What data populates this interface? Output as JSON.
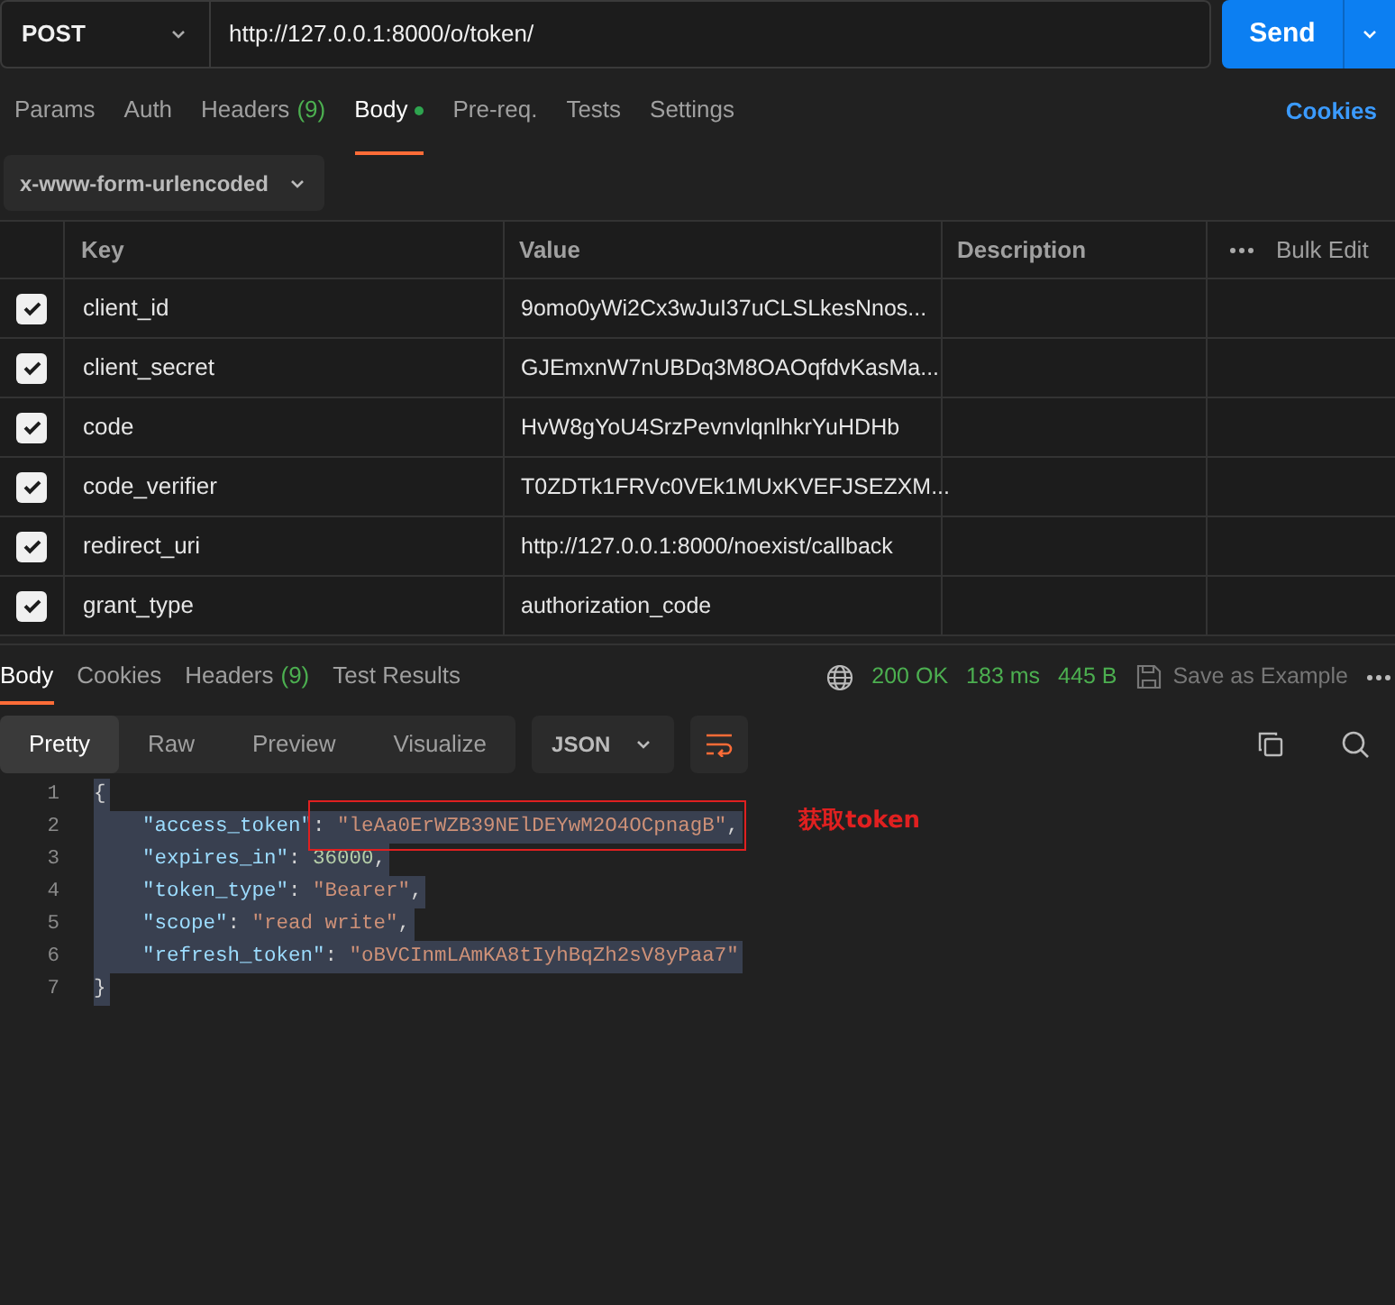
{
  "request": {
    "method": "POST",
    "url": "http://127.0.0.1:8000/o/token/",
    "send": "Send"
  },
  "request_tabs": [
    {
      "label": "Params",
      "selected": false,
      "dot": false
    },
    {
      "label": "Auth",
      "selected": false,
      "dot": false
    },
    {
      "label": "Headers",
      "count": "(9)",
      "selected": false,
      "dot": false
    },
    {
      "label": "Body",
      "selected": true,
      "dot": true
    },
    {
      "label": "Pre-req.",
      "selected": false,
      "dot": false
    },
    {
      "label": "Tests",
      "selected": false,
      "dot": false
    },
    {
      "label": "Settings",
      "selected": false,
      "dot": false
    }
  ],
  "cookies_link": "Cookies",
  "body_type": "x-www-form-urlencoded",
  "table": {
    "columns": [
      "Key",
      "Value",
      "Description"
    ],
    "bulk_edit": "Bulk Edit",
    "rows": [
      {
        "checked": true,
        "key": "client_id",
        "value": "9omo0yWi2Cx3wJuI37uCLSLkesNnos..."
      },
      {
        "checked": true,
        "key": "client_secret",
        "value": "GJEmxnW7nUBDq3M8OAOqfdvKasMa..."
      },
      {
        "checked": true,
        "key": "code",
        "value": "HvW8gYoU4SrzPevnvlqnlhkrYuHDHb"
      },
      {
        "checked": true,
        "key": "code_verifier",
        "value": "T0ZDTk1FRVc0VEk1MUxKVEFJSEZXM..."
      },
      {
        "checked": true,
        "key": "redirect_uri",
        "value": "http://127.0.0.1:8000/noexist/callback"
      },
      {
        "checked": true,
        "key": "grant_type",
        "value": "authorization_code"
      }
    ]
  },
  "response_tabs": [
    {
      "label": "Body",
      "selected": true
    },
    {
      "label": "Cookies",
      "selected": false
    },
    {
      "label": "Headers",
      "count": "(9)",
      "selected": false
    },
    {
      "label": "Test Results",
      "selected": false
    }
  ],
  "status": {
    "code": "200 OK",
    "time": "183 ms",
    "size": "445 B",
    "save": "Save as Example"
  },
  "view_tabs": [
    {
      "label": "Pretty",
      "selected": true
    },
    {
      "label": "Raw",
      "selected": false
    },
    {
      "label": "Preview",
      "selected": false
    },
    {
      "label": "Visualize",
      "selected": false
    }
  ],
  "format": "JSON",
  "code_lines": [
    {
      "number": "1",
      "tokens": [
        {
          "kind": "punct",
          "text": "{"
        }
      ]
    },
    {
      "number": "2",
      "tokens": [
        {
          "kind": "key",
          "text": "    \"access_token\""
        },
        {
          "kind": "punct",
          "text": ": "
        },
        {
          "kind": "string",
          "text": "\"leAa0ErWZB39NElDEYwM2O4OCpnagB\""
        },
        {
          "kind": "punct",
          "text": ","
        }
      ]
    },
    {
      "number": "3",
      "tokens": [
        {
          "kind": "key",
          "text": "    \"expires_in\""
        },
        {
          "kind": "punct",
          "text": ": "
        },
        {
          "kind": "number",
          "text": "36000"
        },
        {
          "kind": "punct",
          "text": ","
        }
      ]
    },
    {
      "number": "4",
      "tokens": [
        {
          "kind": "key",
          "text": "    \"token_type\""
        },
        {
          "kind": "punct",
          "text": ": "
        },
        {
          "kind": "string",
          "text": "\"Bearer\""
        },
        {
          "kind": "punct",
          "text": ","
        }
      ]
    },
    {
      "number": "5",
      "tokens": [
        {
          "kind": "key",
          "text": "    \"scope\""
        },
        {
          "kind": "punct",
          "text": ": "
        },
        {
          "kind": "string",
          "text": "\"read write\""
        },
        {
          "kind": "punct",
          "text": ","
        }
      ]
    },
    {
      "number": "6",
      "tokens": [
        {
          "kind": "key",
          "text": "    \"refresh_token\""
        },
        {
          "kind": "punct",
          "text": ": "
        },
        {
          "kind": "string",
          "text": "\"oBVCInmLAmKA8tIyhBqZh2sV8yPaa7\""
        }
      ]
    },
    {
      "number": "7",
      "tokens": [
        {
          "kind": "punct",
          "text": "}"
        }
      ]
    }
  ],
  "annotation": "获取token"
}
